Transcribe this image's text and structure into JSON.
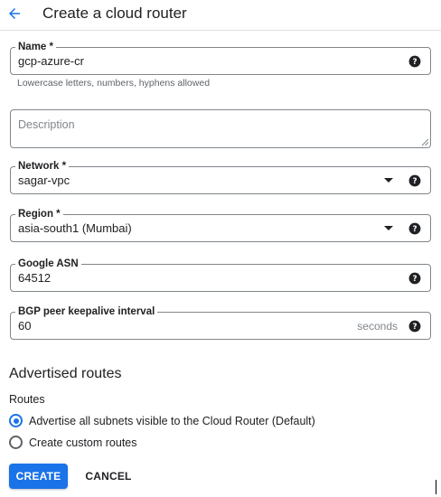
{
  "header": {
    "title": "Create a cloud router",
    "back_icon": "arrow-back-icon"
  },
  "name_field": {
    "label": "Name *",
    "value": "gcp-azure-cr",
    "hint": "Lowercase letters, numbers, hyphens allowed",
    "help_icon": "help-circle-icon"
  },
  "description_field": {
    "placeholder": "Description"
  },
  "network_field": {
    "label": "Network *",
    "value": "sagar-vpc",
    "dropdown_icon": "arrow-drop-down-icon",
    "help_icon": "help-circle-icon"
  },
  "region_field": {
    "label": "Region *",
    "value": "asia-south1 (Mumbai)",
    "dropdown_icon": "arrow-drop-down-icon",
    "help_icon": "help-circle-icon"
  },
  "asn_field": {
    "label": "Google ASN",
    "value": "64512",
    "help_icon": "help-circle-icon"
  },
  "keepalive_field": {
    "label": "BGP peer keepalive interval",
    "value": "60",
    "suffix": "seconds",
    "help_icon": "help-circle-icon"
  },
  "advertised_routes": {
    "title": "Advertised routes",
    "group_label": "Routes",
    "options": [
      {
        "label": "Advertise all subnets visible to the Cloud Router (Default)",
        "checked": true
      },
      {
        "label": "Create custom routes",
        "checked": false
      }
    ]
  },
  "actions": {
    "create_label": "CREATE",
    "cancel_label": "CANCEL"
  },
  "colors": {
    "primary": "#1a73e8",
    "border": "#80868b",
    "text": "#202124",
    "muted": "#5f6368"
  }
}
